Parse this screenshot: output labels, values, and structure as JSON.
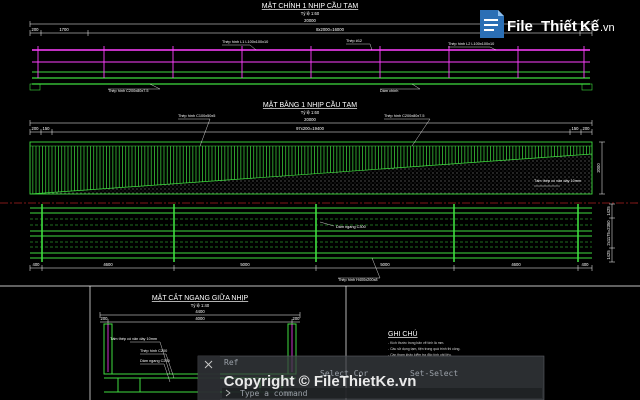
{
  "elevation": {
    "title": "MẶT CHÍNH 1 NHỊP CẦU TẠM",
    "scale": "Tỷ lệ 1:60",
    "overall": "20000",
    "dims": [
      "200",
      "1700",
      "8x2000=16000",
      "200"
    ],
    "labels": {
      "l1": "Thép hình L1 L100x100x10",
      "l2": "Thép #12",
      "l3": "Thép hình L2 L100x100x10",
      "beam": "Thép hình C200x80x7.5",
      "girder": "Dầm chính"
    }
  },
  "plan": {
    "title": "MẶT BẰNG 1 NHỊP CẦU TẠM",
    "scale": "Tỷ lệ 1:60",
    "overall": "20000",
    "top_dims": [
      "200",
      "150",
      "97x200=19400",
      "150",
      "200"
    ],
    "right_dim": "2000",
    "right_dims2": [
      "1425",
      "2x1175=2350",
      "1425"
    ],
    "bottom_dims": [
      "400",
      "4600",
      "5000",
      "5000",
      "4600",
      "400"
    ],
    "labels": {
      "c100": "Thép hình C100x50x5",
      "c200": "Thép hình C200x80x7.5",
      "plate": "Tấm thép có vân dày 10mm",
      "cross": "Dầm ngang C300",
      "main": "Thép hình H400x200x8"
    }
  },
  "section": {
    "title": "MẶT CẮT NGANG GIỮA NHỊP",
    "scale": "Tỷ lệ 1:40",
    "width": "4400",
    "dims": [
      "200",
      "4000",
      "200"
    ],
    "labels": {
      "plate": "Tấm thép có vân dày 10mm",
      "c200": "Thép hình C200",
      "c250": "Dầm ngang C250"
    }
  },
  "notes": {
    "title": "GHI CHÚ",
    "lines": [
      "- Kích thước trong bản vẽ tính là mm.",
      "- Cầu sử dụng tạm, tiện trong quá trình thi công.",
      "- Cần tham khảo kiểm tra đặc tính vật liệu."
    ]
  },
  "command": {
    "prompt": "Type a command",
    "history": [
      "Ref",
      "Select Cor",
      "Set-Select"
    ]
  },
  "watermark": {
    "logo_file": "File",
    "logo_thiet": "Thiết",
    "logo_ke": "Kế",
    "logo_domain": ".vn",
    "copyright": "Copyright © FileThietKe.vn"
  },
  "colors": {
    "structure": "#3fdc3f",
    "magenta": "#ff40ff",
    "dim": "#ffffff",
    "centerline": "#ff3030",
    "soil": "#d0d0d0"
  }
}
